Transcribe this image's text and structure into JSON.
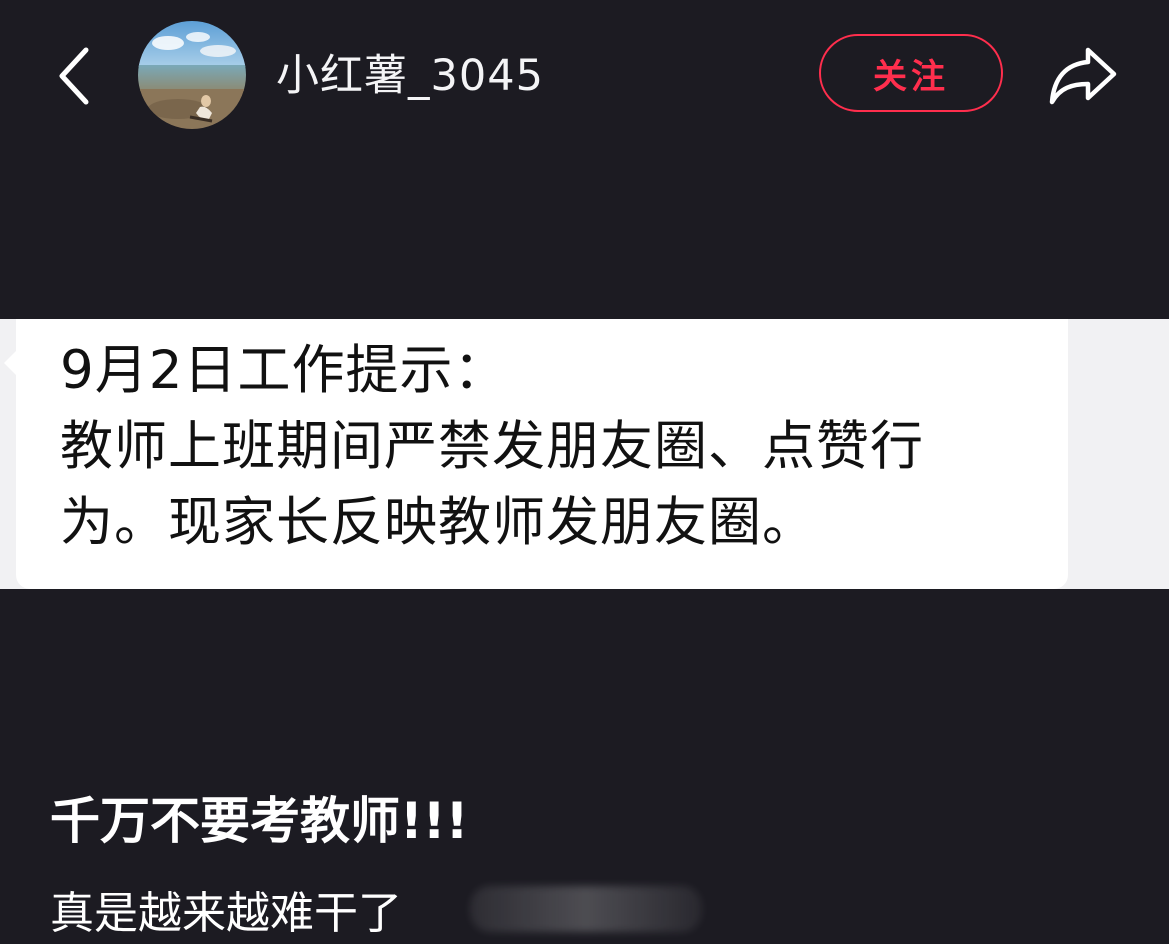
{
  "header": {
    "username": "小红薯_3045",
    "follow_label": "关注",
    "back_icon": "chevron-left-icon",
    "share_icon": "share-arrow-icon"
  },
  "post_image": {
    "lines": [
      "9月2日工作提示：",
      "教师上班期间严禁发朋友圈、点赞行",
      "为。现家长反映教师发朋友圈。"
    ]
  },
  "caption": {
    "title": "千万不要考教师!!!",
    "body": "真是越来越难干了"
  },
  "colors": {
    "background": "#1c1b22",
    "accent": "#ff2e4d",
    "bubble": "#ffffff"
  }
}
